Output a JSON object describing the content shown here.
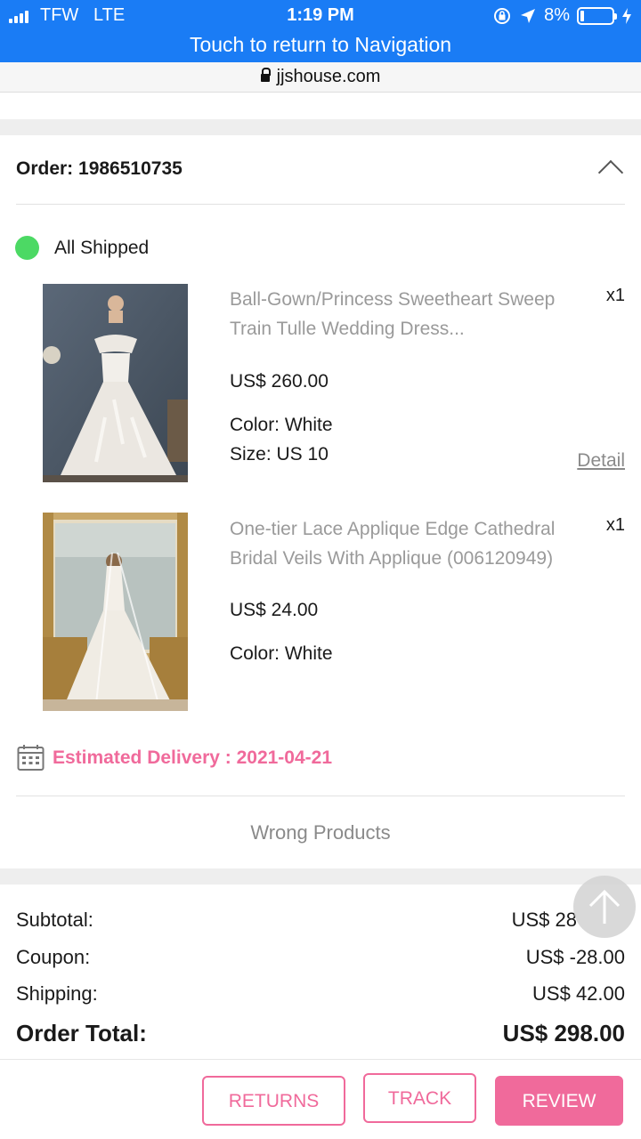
{
  "status_bar": {
    "carrier": "TFW",
    "network": "LTE",
    "time": "1:19 PM",
    "battery": "8%",
    "battery_level": 0.08,
    "return_banner": "Touch to return to Navigation"
  },
  "browser": {
    "url": "jjshouse.com"
  },
  "order": {
    "title": "Order: 1986510735",
    "status": "All Shipped",
    "status_color": "#4cd964",
    "items": [
      {
        "name": "Ball-Gown/Princess Sweetheart Sweep Train Tulle Wedding Dress...",
        "quantity": "x1",
        "price": "US$ 260.00",
        "color": "Color: White",
        "size": "Size: US 10",
        "detail_link": "Detail",
        "image": "wedding-dress-photo"
      },
      {
        "name": "One-tier Lace Applique Edge Cathedral Bridal Veils With Applique (006120949)",
        "quantity": "x1",
        "price": "US$ 24.00",
        "color": "Color: White",
        "image": "bridal-veil-photo"
      }
    ],
    "estimated_delivery": "Estimated Delivery : 2021-04-21",
    "wrong_products": "Wrong Products"
  },
  "totals": {
    "subtotal_label": "Subtotal:",
    "subtotal_value": "US$ 28",
    "coupon_label": "Coupon:",
    "coupon_value": "US$ -28.00",
    "shipping_label": "Shipping:",
    "shipping_value": "US$ 42.00",
    "total_label": "Order Total:",
    "total_value": "US$ 298.00"
  },
  "actions": {
    "returns": "RETURNS",
    "track": "TRACK",
    "review": "REVIEW"
  },
  "colors": {
    "status_bar": "#1a7cf5",
    "accent_pink": "#f06a9b",
    "shipped_green": "#4cd964"
  },
  "icons": [
    "signal-icon",
    "lock-icon",
    "chevron-up-icon",
    "calendar-icon",
    "arrow-up-icon",
    "location-icon",
    "rotation-lock-icon",
    "battery-icon",
    "charging-icon"
  ]
}
